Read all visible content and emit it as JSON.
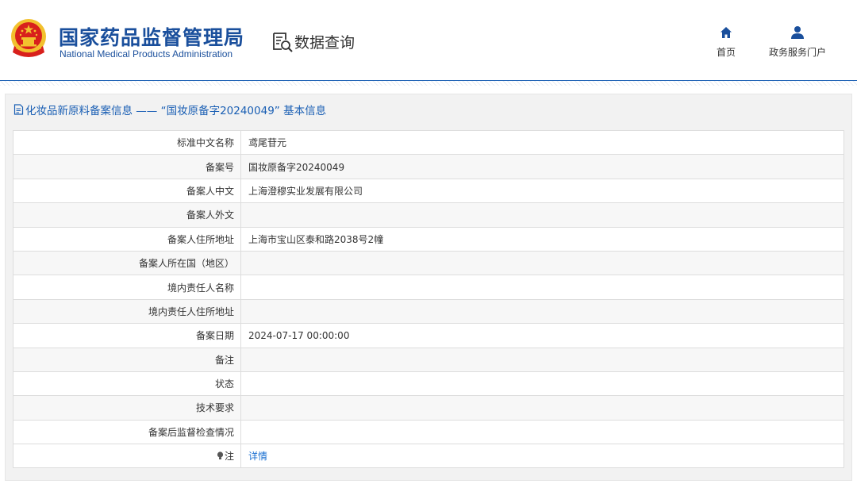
{
  "header": {
    "org_name_cn": "国家药品监督管理局",
    "org_name_en": "National Medical Products Administration",
    "query_label": "数据查询",
    "nav": [
      {
        "label": "首页",
        "icon": "home-icon"
      },
      {
        "label": "政务服务门户",
        "icon": "user-icon"
      }
    ]
  },
  "panel": {
    "title": "化妆品新原料备案信息 —— “国妆原备字20240049” 基本信息"
  },
  "rows": [
    {
      "label": "标准中文名称",
      "value": "鸢尾苷元"
    },
    {
      "label": "备案号",
      "value": "国妆原备字20240049"
    },
    {
      "label": "备案人中文",
      "value": "上海澄穆实业发展有限公司"
    },
    {
      "label": "备案人外文",
      "value": ""
    },
    {
      "label": "备案人住所地址",
      "value": "上海市宝山区泰和路2038号2幢"
    },
    {
      "label": "备案人所在国（地区）",
      "value": ""
    },
    {
      "label": "境内责任人名称",
      "value": ""
    },
    {
      "label": "境内责任人住所地址",
      "value": ""
    },
    {
      "label": "备案日期",
      "value": "2024-07-17 00:00:00"
    },
    {
      "label": "备注",
      "value": ""
    },
    {
      "label": "状态",
      "value": ""
    },
    {
      "label": "技术要求",
      "value": ""
    },
    {
      "label": "备案后监督检查情况",
      "value": ""
    }
  ],
  "note_row": {
    "label": "注",
    "link": "详情"
  },
  "colors": {
    "brand": "#1a4f9c",
    "link": "#1a6fd1",
    "emblem_red": "#d8201c",
    "emblem_gold": "#f2c12e"
  }
}
